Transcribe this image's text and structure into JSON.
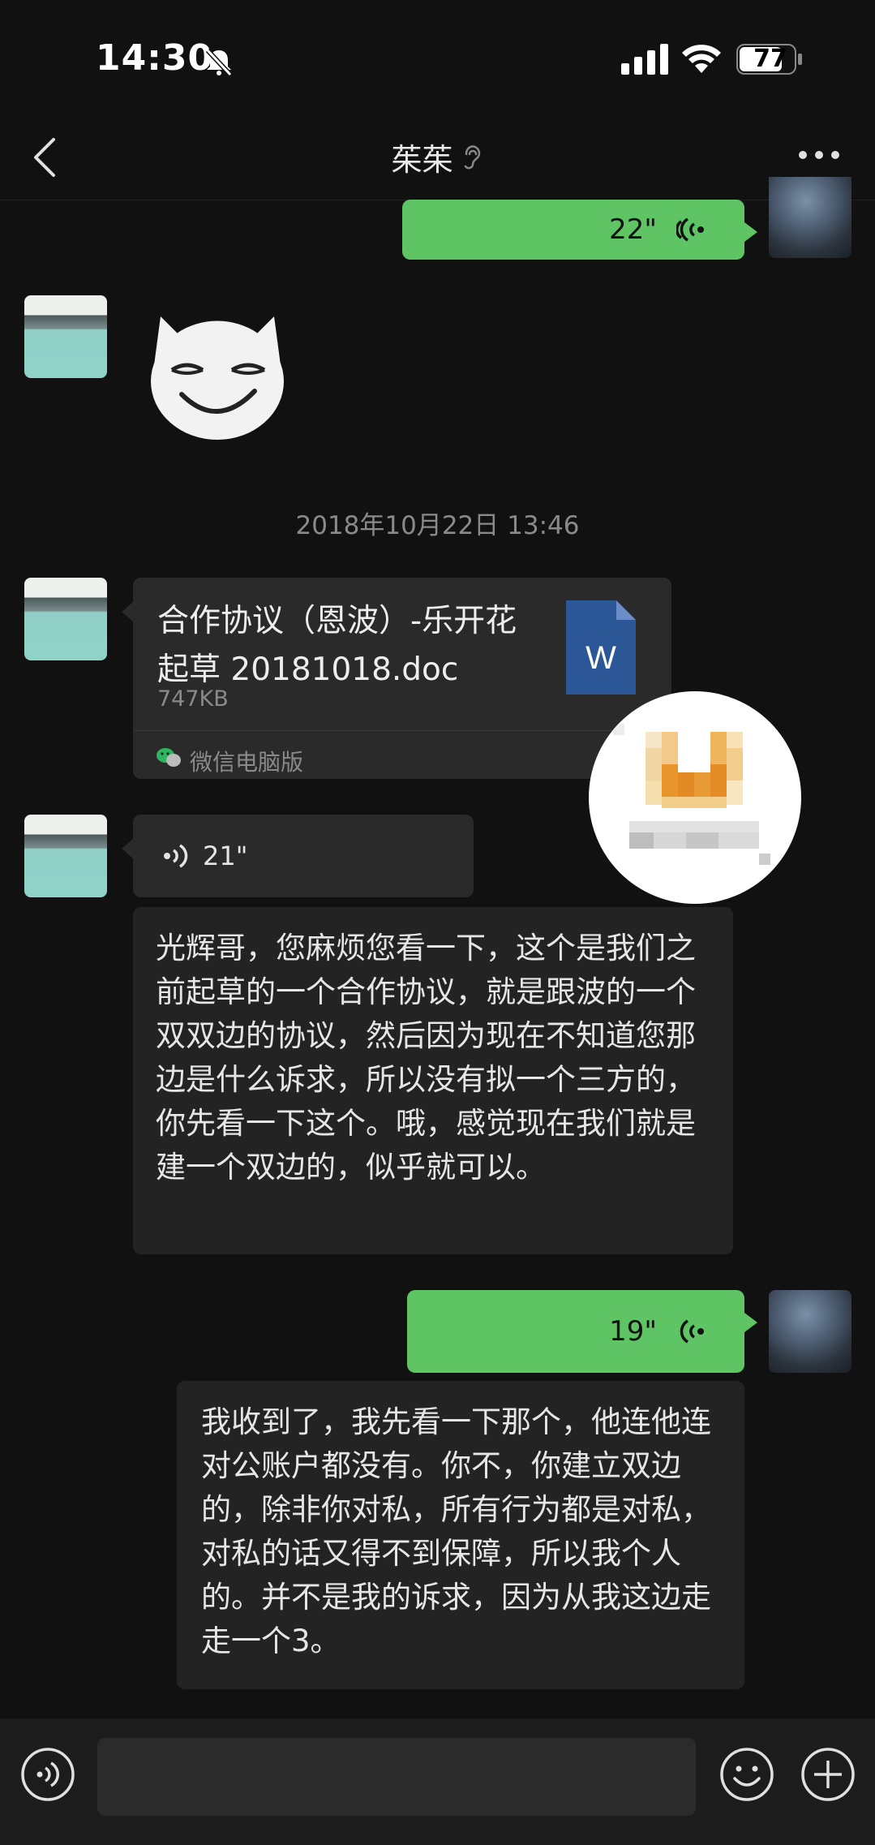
{
  "status_bar": {
    "time": "14:30",
    "battery": "77"
  },
  "nav": {
    "title": "茱茱"
  },
  "messages": {
    "voice_sent_1": {
      "duration": "22\""
    },
    "timestamp": "2018年10月22日 13:46",
    "file": {
      "name": "合作协议（恩波）-乐开花起草 20181018.doc",
      "size": "747KB",
      "source": "微信电脑版",
      "type_letter": "W"
    },
    "voice_received": {
      "duration": "21\"",
      "transcript": "光辉哥，您麻烦您看一下，这个是我们之前起草的一个合作协议，就是跟波的一个双双边的协议，然后因为现在不知道您那边是什么诉求，所以没有拟一个三方的，你先看一下这个。哦，感觉现在我们就是建一个双边的，似乎就可以。"
    },
    "voice_sent_2": {
      "duration": "19\"",
      "transcript": "我收到了，我先看一下那个，他连他连对公账户都没有。你不，你建立双边的，除非你对私，所有行为都是对私，对私的话又得不到保障，所以我个人的。并不是我的诉求，因为从我这边走走一个3。"
    }
  },
  "colors": {
    "sent_bubble": "#5ec464",
    "received_bubble": "#2a2a2a",
    "background": "#111111"
  },
  "icons": [
    "bell-mute-icon",
    "signal-icon",
    "wifi-icon",
    "battery-icon",
    "back-icon",
    "ear-icon",
    "more-icon",
    "voice-input-icon",
    "emoji-icon",
    "plus-icon",
    "word-file-icon",
    "wechat-icon"
  ]
}
